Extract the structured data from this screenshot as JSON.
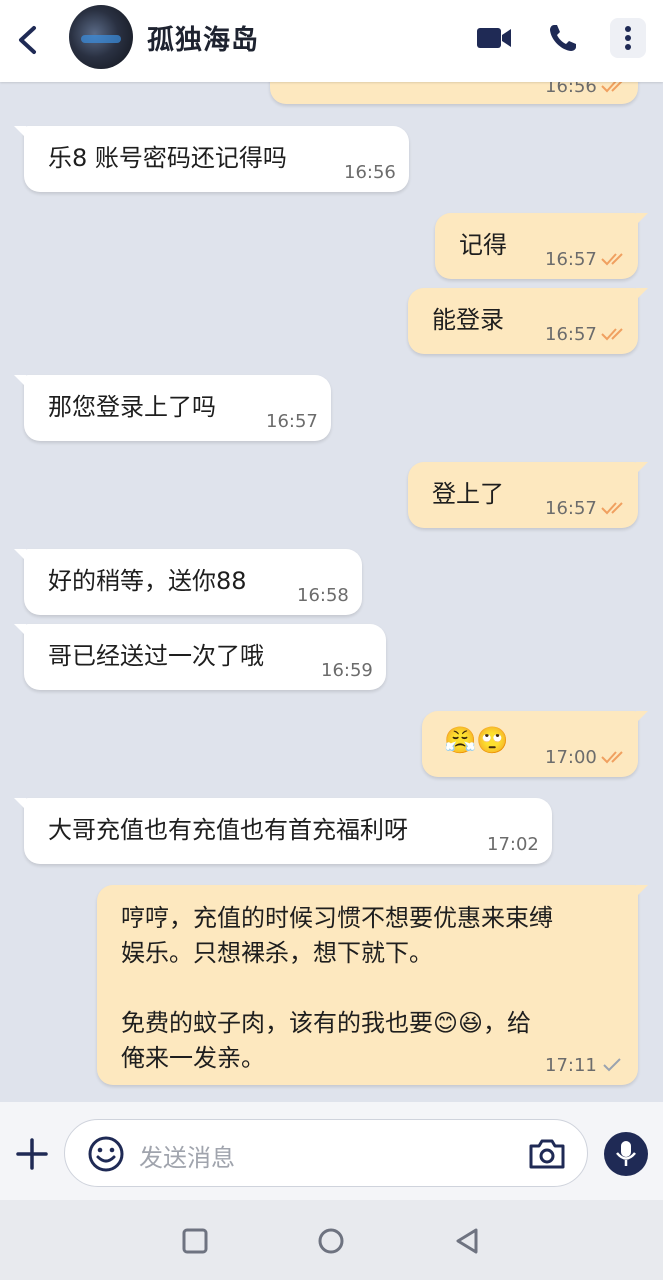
{
  "header": {
    "title": "孤独海岛",
    "icons": [
      "back-arrow-icon",
      "video-camera-icon",
      "phone-icon",
      "more-vert-icon"
    ],
    "accent_color": "#1f2a55"
  },
  "messages": [
    {
      "dir": "out",
      "text": "",
      "time": "16:56",
      "ticks": "read"
    },
    {
      "dir": "in",
      "text": "乐8 账号密码还记得吗",
      "time": "16:56"
    },
    {
      "dir": "out",
      "text": "记得",
      "time": "16:57",
      "ticks": "read"
    },
    {
      "dir": "out",
      "text": "能登录",
      "time": "16:57",
      "ticks": "read"
    },
    {
      "dir": "in",
      "text": "那您登录上了吗",
      "time": "16:57"
    },
    {
      "dir": "out",
      "text": "登上了",
      "time": "16:57",
      "ticks": "read"
    },
    {
      "dir": "in",
      "text": "好的稍等，送你88",
      "time": "16:58"
    },
    {
      "dir": "in",
      "text": "哥已经送过一次了哦",
      "time": "16:59"
    },
    {
      "dir": "out",
      "text": "😤🙄",
      "time": "17:00",
      "ticks": "read"
    },
    {
      "dir": "in",
      "text": "大哥充值也有充值也有首充福利呀",
      "time": "17:02"
    },
    {
      "dir": "out",
      "lines": [
        "哼哼，充值的时候习惯不想要优惠来束缚",
        "娱乐。只想裸杀，想下就下。",
        "",
        "免费的蚊子肉，该有的我也要😊😆，给",
        "俺来一发亲。"
      ],
      "time": "17:11",
      "ticks": "sent"
    }
  ],
  "composer": {
    "placeholder": "发送消息",
    "icons": [
      "plus-icon",
      "emoji-icon",
      "camera-icon",
      "mic-icon"
    ]
  },
  "colors": {
    "chat_background": "#dfe3ec",
    "incoming_bubble": "#ffffff",
    "outgoing_bubble": "#fde8bf",
    "read_ticks": "#f0a060",
    "sent_tick": "#9aa3b0"
  }
}
